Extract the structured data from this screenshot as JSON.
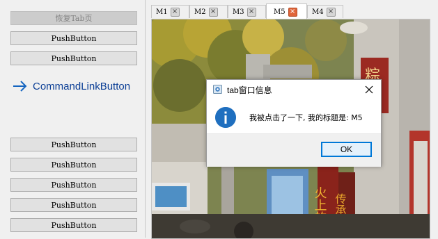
{
  "left_panel": {
    "restore_button": "恢复Tab页",
    "push_buttons": [
      "PushButton",
      "PushButton",
      "PushButton",
      "PushButton",
      "PushButton",
      "PushButton",
      "PushButton"
    ],
    "command_link": "CommandLinkButton"
  },
  "tabs": [
    {
      "label": "M1",
      "active": false
    },
    {
      "label": "M2",
      "active": false
    },
    {
      "label": "M3",
      "active": false
    },
    {
      "label": "M5",
      "active": true
    },
    {
      "label": "M4",
      "active": false
    }
  ],
  "scene": {
    "shop_sign_char": "粽",
    "vertical_sign_text": "火上的",
    "vertical_sign_text_2": "传承"
  },
  "dialog": {
    "title": "tab窗口信息",
    "message": "我被点击了一下, 我的标题是: M5",
    "ok_label": "OK",
    "icon": "information-icon"
  },
  "colors": {
    "accent": "#0078d7",
    "command_link": "#0c3f96",
    "info_icon": "#1f6fbf",
    "active_tab_close": "#e0653a"
  }
}
